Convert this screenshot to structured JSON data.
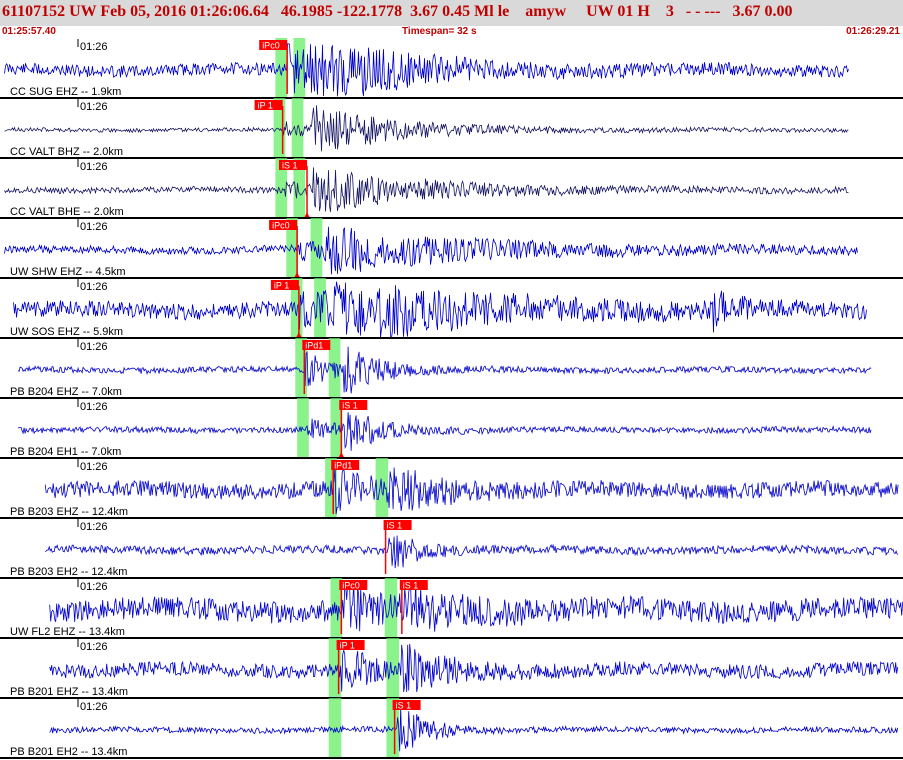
{
  "header": {
    "title": "61107152 UW Feb 05, 2016 01:26:06.64   46.1985 -122.1778  3.67 0.45 Ml le    amyw     UW 01 H    3   - - ---   3.67 0.00",
    "start_time": "01:25:57.40",
    "timespan": "Timespan=  32 s",
    "end_time": "01:26:29.21"
  },
  "colors": {
    "header_bg": "#d9d9d9",
    "header_text": "#c00000",
    "trace": "#0000cc",
    "trace_dark": "#1a1a66",
    "pick": "#ff0000",
    "window": "#66ee66",
    "separator": "#000000"
  },
  "traces": [
    {
      "label": "CC SUG EHZ -- 1.9km",
      "time": "01:26",
      "color": "trace",
      "amp": 6,
      "seed": 11,
      "start": 0.005,
      "end": 0.94,
      "picks": [
        {
          "label": "iPc0",
          "t": 0.318,
          "flag_left": true,
          "arrow": false
        }
      ],
      "windows": [
        [
          0.305,
          0.318
        ],
        [
          0.325,
          0.338
        ]
      ],
      "events": [
        {
          "t": 0.318,
          "a": 34,
          "d": 0.06
        },
        {
          "t": 0.34,
          "a": 22,
          "d": 0.12
        }
      ]
    },
    {
      "label": "CC VALT BHZ -- 2.0km",
      "time": "01:26",
      "color": "trace_dark",
      "amp": 2,
      "seed": 23,
      "start": 0.005,
      "end": 0.94,
      "picks": [
        {
          "label": "iP 1",
          "t": 0.313,
          "flag_left": true,
          "arrow": false
        }
      ],
      "windows": [
        [
          0.303,
          0.316
        ],
        [
          0.323,
          0.336
        ]
      ],
      "events": [
        {
          "t": 0.313,
          "a": 8,
          "d": 0.04
        },
        {
          "t": 0.345,
          "a": 22,
          "d": 0.1
        }
      ]
    },
    {
      "label": "CC VALT BHE -- 2.0km",
      "time": "01:26",
      "color": "trace_dark",
      "amp": 3,
      "seed": 37,
      "start": 0.005,
      "end": 0.94,
      "picks": [
        {
          "label": "iS 1",
          "t": 0.34,
          "flag_left": true,
          "arrow": true
        }
      ],
      "windows": [
        [
          0.305,
          0.318
        ],
        [
          0.325,
          0.338
        ]
      ],
      "events": [
        {
          "t": 0.313,
          "a": 10,
          "d": 0.03
        },
        {
          "t": 0.345,
          "a": 22,
          "d": 0.12
        }
      ]
    },
    {
      "label": "UW SHW EHZ -- 4.5km",
      "time": "01:26",
      "color": "trace",
      "amp": 4,
      "seed": 41,
      "start": 0.005,
      "end": 0.95,
      "picks": [
        {
          "label": "iPc0",
          "t": 0.329,
          "flag_left": true,
          "arrow": true
        }
      ],
      "windows": [
        [
          0.317,
          0.33
        ],
        [
          0.344,
          0.357
        ]
      ],
      "events": [
        {
          "t": 0.329,
          "a": 12,
          "d": 0.05
        },
        {
          "t": 0.36,
          "a": 18,
          "d": 0.18
        }
      ]
    },
    {
      "label": "UW SOS EHZ -- 5.9km",
      "time": "01:26",
      "color": "trace",
      "amp": 8,
      "seed": 53,
      "start": 0.015,
      "end": 0.96,
      "picks": [
        {
          "label": "iP 1",
          "t": 0.331,
          "flag_left": true,
          "arrow": true
        }
      ],
      "windows": [
        [
          0.322,
          0.335
        ],
        [
          0.348,
          0.361
        ]
      ],
      "events": [
        {
          "t": 0.331,
          "a": 20,
          "d": 0.05
        },
        {
          "t": 0.37,
          "a": 26,
          "d": 0.16
        },
        {
          "t": 0.79,
          "a": 16,
          "d": 0.02
        }
      ]
    },
    {
      "label": "PB B204 EHZ -- 7.0km",
      "time": "01:26",
      "color": "trace",
      "amp": 3,
      "seed": 67,
      "start": 0.02,
      "end": 0.965,
      "picks": [
        {
          "label": "iPd1",
          "t": 0.337,
          "flag_left": false,
          "arrow": false
        }
      ],
      "windows": [
        [
          0.327,
          0.34
        ],
        [
          0.364,
          0.377
        ]
      ],
      "events": [
        {
          "t": 0.337,
          "a": 18,
          "d": 0.03
        },
        {
          "t": 0.38,
          "a": 22,
          "d": 0.04
        }
      ]
    },
    {
      "label": "PB B204 EH1 -- 7.0km",
      "time": "01:26",
      "color": "trace",
      "amp": 3,
      "seed": 71,
      "start": 0.02,
      "end": 0.965,
      "picks": [
        {
          "label": "iS 1",
          "t": 0.378,
          "flag_left": false,
          "arrow": true
        }
      ],
      "windows": [
        [
          0.329,
          0.342
        ],
        [
          0.366,
          0.379
        ]
      ],
      "events": [
        {
          "t": 0.34,
          "a": 10,
          "d": 0.03
        },
        {
          "t": 0.38,
          "a": 22,
          "d": 0.04
        }
      ]
    },
    {
      "label": "PB B203 EHZ -- 12.4km",
      "time": "01:26",
      "color": "trace",
      "amp": 8,
      "seed": 83,
      "start": 0.05,
      "end": 0.995,
      "picks": [
        {
          "label": "iPd1",
          "t": 0.369,
          "flag_left": false,
          "arrow": false
        }
      ],
      "windows": [
        [
          0.36,
          0.373
        ],
        [
          0.416,
          0.43
        ]
      ],
      "events": [
        {
          "t": 0.369,
          "a": 20,
          "d": 0.03
        },
        {
          "t": 0.428,
          "a": 22,
          "d": 0.05
        }
      ]
    },
    {
      "label": "PB B203 EH2 -- 12.4km",
      "time": "01:26",
      "color": "trace",
      "amp": 4,
      "seed": 97,
      "start": 0.05,
      "end": 0.995,
      "picks": [
        {
          "label": "iS 1",
          "t": 0.427,
          "flag_left": false,
          "arrow": false
        }
      ],
      "windows": [],
      "events": [
        {
          "t": 0.43,
          "a": 22,
          "d": 0.03
        }
      ]
    },
    {
      "label": "UW FL2 EHZ -- 13.4km",
      "time": "01:26",
      "color": "trace",
      "amp": 11,
      "seed": 101,
      "start": 0.055,
      "end": 1.0,
      "picks": [
        {
          "label": "iPc0",
          "t": 0.378,
          "flag_left": false,
          "arrow": false
        },
        {
          "label": "iS 1",
          "t": 0.445,
          "flag_left": false,
          "arrow": false
        }
      ],
      "windows": [
        [
          0.366,
          0.379
        ],
        [
          0.426,
          0.44
        ]
      ],
      "events": [
        {
          "t": 0.38,
          "a": 20,
          "d": 0.04
        },
        {
          "t": 0.445,
          "a": 20,
          "d": 0.06
        }
      ]
    },
    {
      "label": "PB B201 EHZ -- 13.4km",
      "time": "01:26",
      "color": "trace",
      "amp": 7,
      "seed": 113,
      "start": 0.055,
      "end": 0.995,
      "picks": [
        {
          "label": "iP 1",
          "t": 0.375,
          "flag_left": false,
          "arrow": false
        }
      ],
      "windows": [
        [
          0.364,
          0.378
        ],
        [
          0.428,
          0.442
        ]
      ],
      "events": [
        {
          "t": 0.378,
          "a": 22,
          "d": 0.03
        },
        {
          "t": 0.44,
          "a": 26,
          "d": 0.05
        }
      ]
    },
    {
      "label": "PB B201 EH2 -- 13.4km",
      "time": "01:26",
      "color": "trace",
      "amp": 3,
      "seed": 127,
      "start": 0.055,
      "end": 0.995,
      "picks": [
        {
          "label": "iS 1",
          "t": 0.437,
          "flag_left": false,
          "arrow": false
        }
      ],
      "windows": [
        [
          0.364,
          0.378
        ],
        [
          0.428,
          0.442
        ]
      ],
      "events": [
        {
          "t": 0.44,
          "a": 28,
          "d": 0.03
        }
      ]
    }
  ]
}
